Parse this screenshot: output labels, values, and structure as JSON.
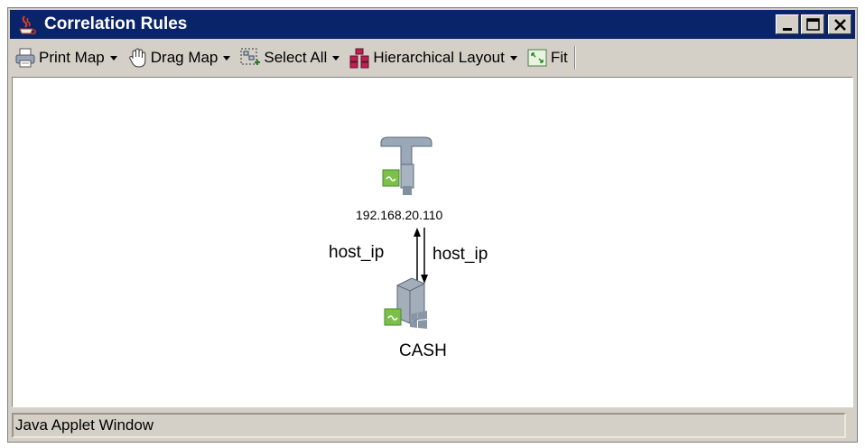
{
  "window": {
    "title": "Correlation Rules"
  },
  "toolbar": {
    "print_map": "Print Map",
    "drag_map": "Drag Map",
    "select_all": "Select All",
    "hierarchical_layout": "Hierarchical Layout",
    "fit": "Fit"
  },
  "map": {
    "nodes": [
      {
        "label": "192.168.20.110",
        "icon": "network-tap-icon"
      },
      {
        "label": "CASH",
        "icon": "server-icon"
      }
    ],
    "edges": [
      {
        "label": "host_ip"
      },
      {
        "label": "host_ip"
      }
    ]
  },
  "status_bar": {
    "text": "Java Applet Window"
  },
  "colors": {
    "titlebar": "#0a246a",
    "chrome": "#d4d0c8",
    "status_green": "#7cc04a"
  }
}
